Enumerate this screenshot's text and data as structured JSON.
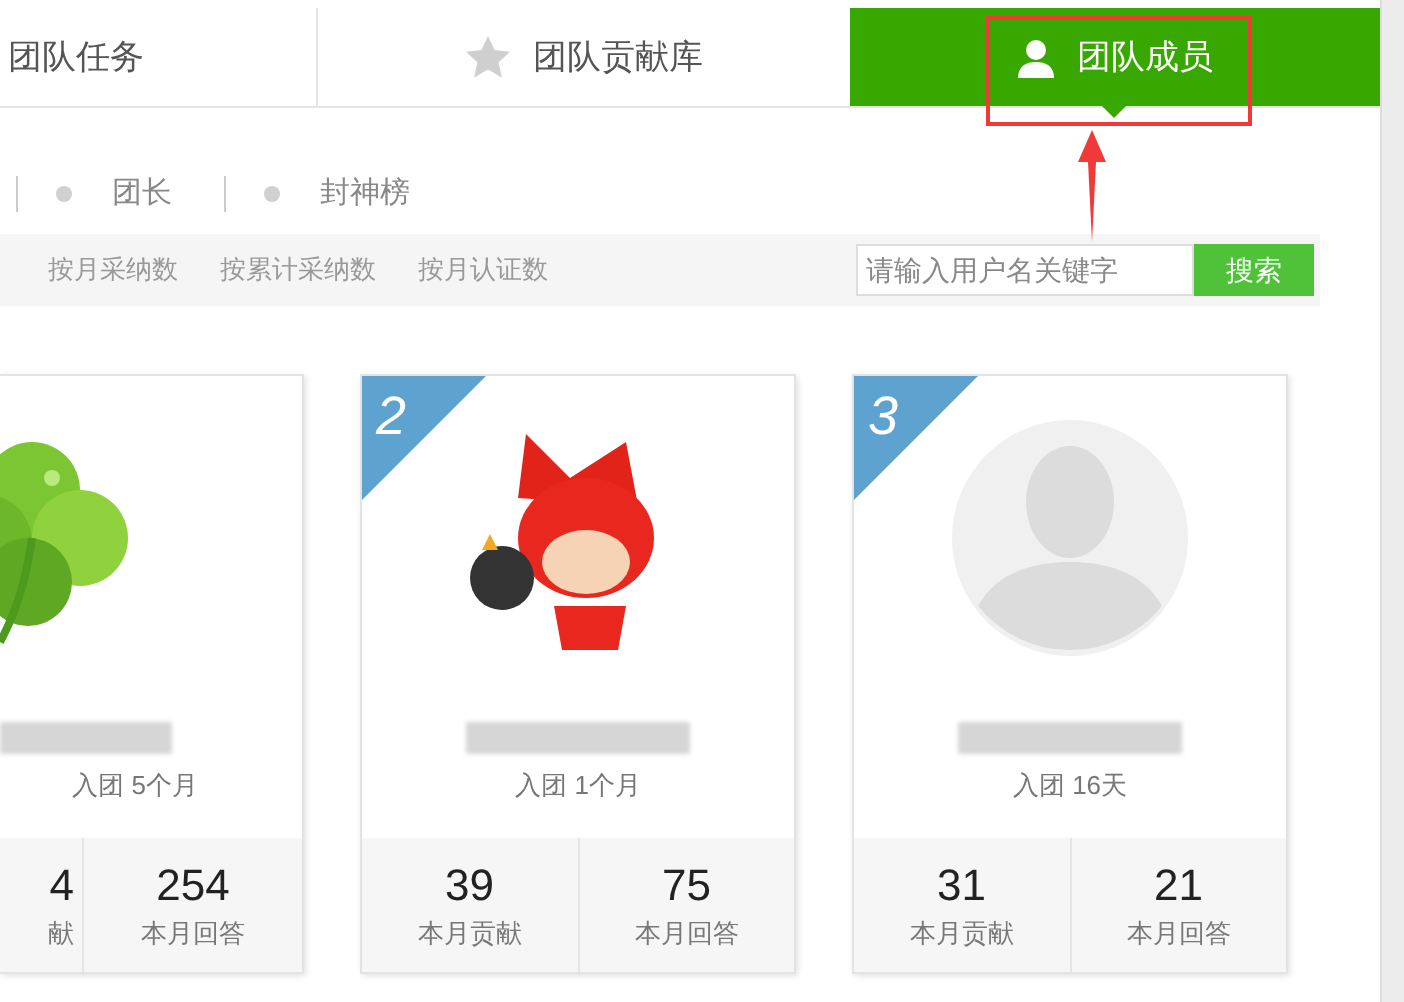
{
  "tabs": [
    {
      "label": "团队任务",
      "kind": "plain",
      "selected": false
    },
    {
      "label": "团队贡献库",
      "kind": "star",
      "selected": false
    },
    {
      "label": "团队成员",
      "kind": "person",
      "selected": true
    }
  ],
  "annotation": {
    "highlight": true
  },
  "subnav": [
    "团长",
    "封神榜"
  ],
  "sort_options": [
    "按月采纳数",
    "按累计采纳数",
    "按月认证数"
  ],
  "search": {
    "placeholder": "请输入用户名关键字",
    "button": "搜索"
  },
  "members": [
    {
      "kind": "picture",
      "joined": "入团 5个月",
      "stats": [
        {
          "value": "4",
          "label": "献"
        },
        {
          "value": "254",
          "label": "本月回答"
        }
      ]
    },
    {
      "rank": "2",
      "kind": "picture",
      "joined": "入团 1个月",
      "stats": [
        {
          "value": "39",
          "label": "本月贡献"
        },
        {
          "value": "75",
          "label": "本月回答"
        }
      ]
    },
    {
      "rank": "3",
      "kind": "placeholder",
      "joined": "入团 16天",
      "stats": [
        {
          "value": "31",
          "label": "本月贡献"
        },
        {
          "value": "21",
          "label": "本月回答"
        }
      ]
    }
  ]
}
